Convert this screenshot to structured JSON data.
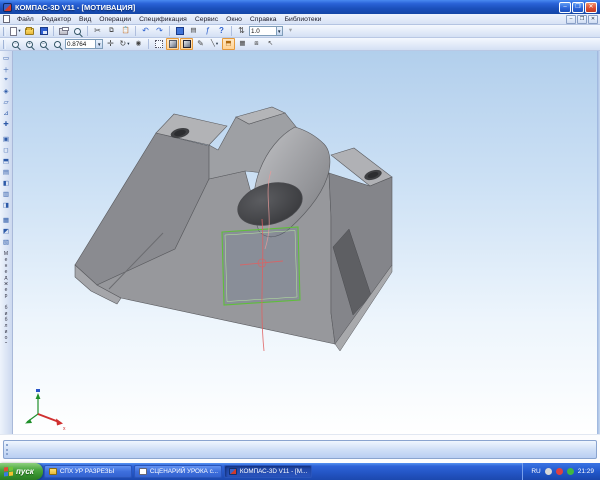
{
  "window": {
    "title": "КОМПАС-3D V11 - [МОТИВАЦИЯ]"
  },
  "menu": {
    "items": [
      "Файл",
      "Редактор",
      "Вид",
      "Операции",
      "Спецификация",
      "Сервис",
      "Окно",
      "Справка",
      "Библиотеки"
    ]
  },
  "toolbars": {
    "document_scale": "1.0",
    "view_zoom": "0.8764"
  },
  "sidebar": {
    "vertical_tab_label": "Менеджер библиотек"
  },
  "statusbar": {
    "text": ""
  },
  "taskbar": {
    "start_label": "пуск",
    "tasks": [
      {
        "label": "СПХ УР РАЗРЕЗЫ"
      },
      {
        "label": "СЦЕНАРИЙ УРОКА с..."
      },
      {
        "label": "КОМПАС-3D V11 - [М..."
      }
    ],
    "tray": {
      "language": "RU",
      "time": "21:29"
    }
  },
  "colors": {
    "sketch_green": "#5fbf3a",
    "axis_red": "#e06060",
    "active_tool_orange": "#e49a3c",
    "taskbar_blue": "#2456c6",
    "start_green": "#318a2a",
    "part_gray": "#97989c"
  }
}
